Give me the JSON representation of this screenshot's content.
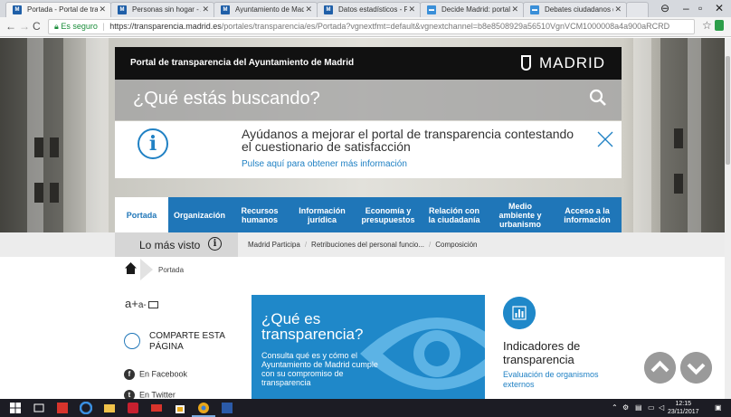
{
  "browser": {
    "tabs": [
      {
        "label": "Portada - Portal de tran",
        "favicon_color": "#1f5fa8"
      },
      {
        "label": "Personas sin hogar - A",
        "favicon_color": "#1f5fa8"
      },
      {
        "label": "Ayuntamiento de Mad",
        "favicon_color": "#1f5fa8"
      },
      {
        "label": "Datos estadísticos - Po",
        "favicon_color": "#1f5fa8"
      },
      {
        "label": "Decide Madrid: portal",
        "favicon_color": "#3a8fd8"
      },
      {
        "label": "Debates ciudadanos de",
        "favicon_color": "#3a8fd8"
      }
    ],
    "secure_label": "Es seguro",
    "url_host": "https://transparencia.madrid.es",
    "url_path": "/portales/transparencia/es/Portada?vgnextfmt=default&vgnextchannel=b8e8508929a56510VgnVCM1000008a4a900aRCRD"
  },
  "site": {
    "portal_title": "Portal de transparencia del Ayuntamiento de Madrid",
    "brand": "MADRID",
    "search_placeholder": "¿Qué estás buscando?",
    "notice_text": "Ayúdanos a mejorar el portal de transparencia contestando el cuestionario de satisfacción",
    "notice_link": "Pulse aquí para obtener más información",
    "nav": [
      {
        "label": "Portada",
        "active": true
      },
      {
        "label": "Organización"
      },
      {
        "label": "Recursos humanos"
      },
      {
        "label": "Información jurídica"
      },
      {
        "label": "Economía y presupuestos"
      },
      {
        "label": "Relación con la ciudadanía"
      },
      {
        "label": "Medio ambiente y urbanismo"
      },
      {
        "label": "Acceso a la información"
      }
    ],
    "lo_mas_visto": "Lo más visto",
    "popular_links": [
      "Madrid Participa",
      "Retribuciones del personal funcio...",
      "Composición"
    ],
    "breadcrumb": "Portada",
    "font_big": "a+",
    "font_small": "a-",
    "share_label": "COMPARTE ESTA PÁGINA",
    "facebook": "En Facebook",
    "twitter": "En Twitter",
    "card_title": "¿Qué es transparencia?",
    "card_desc": "Consulta qué es y cómo el Ayuntamiento de Madrid cumple con su compromiso de transparencia",
    "indicators_title": "Indicadores de transparencia",
    "indicators_link": "Evaluación de organismos externos"
  },
  "taskbar": {
    "time": "12:15",
    "date": "23/11/2017"
  },
  "colors": {
    "brand_blue": "#1f76b8",
    "link_blue": "#2081c4",
    "card_blue": "#1f88c9"
  }
}
